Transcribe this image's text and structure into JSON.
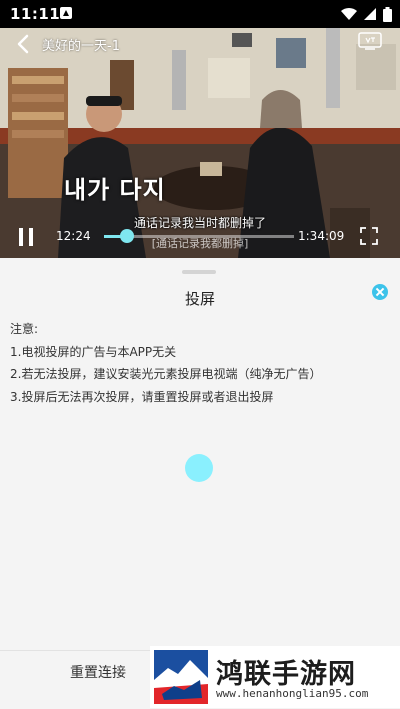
{
  "statusbar": {
    "time": "11:11"
  },
  "player": {
    "title": "美好的一天-1",
    "overlay_text": "내가 다지",
    "subtitle": "通话记录我当时都删掉了",
    "subtitle_echo": "[通话记录我都删掉]",
    "current_time": "12:24",
    "total_time": "1:34:09",
    "progress": 0.12,
    "is_playing": true
  },
  "sheet": {
    "title": "投屏",
    "notes": [
      "注意:",
      "1.电视投屏的广告与本APP无关",
      "2.若无法投屏，建议安装光元素投屏电视端（纯净无广告）",
      "3.投屏后无法再次投屏，请重置投屏或者退出投屏"
    ],
    "reset_label": "重置连接"
  },
  "watermark": {
    "text": "鸿联手游网",
    "url": "www.henanhonglian95.com"
  },
  "colors": {
    "accent": "#7fe7f0",
    "close": "#3cc3ea",
    "sheet_bg": "#f4f4f4"
  }
}
